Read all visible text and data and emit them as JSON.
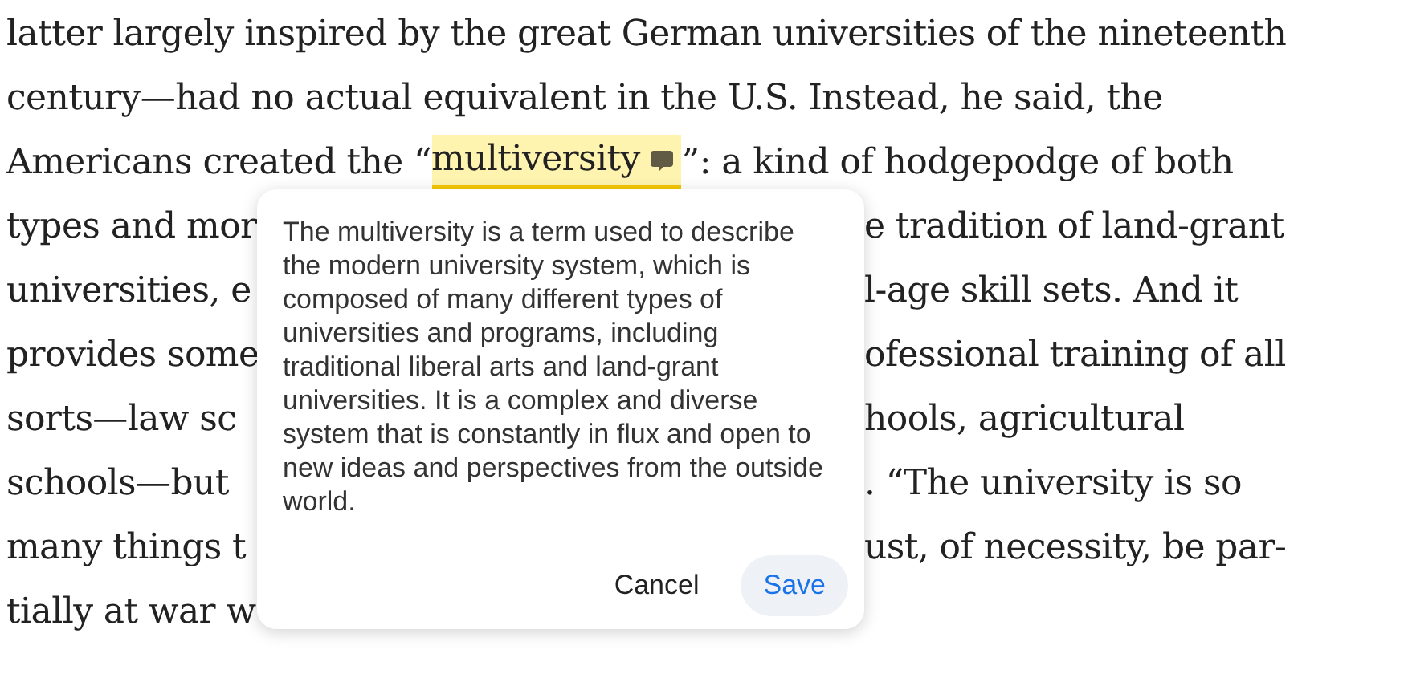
{
  "article": {
    "lines": [
      {
        "kind": "plain",
        "left": "latter largely inspired by the great German universities of the nineteenth"
      },
      {
        "kind": "plain",
        "left": "century—had no actual equivalent in the U.S. Instead, he said, the"
      },
      {
        "kind": "highlight",
        "before": "Americans created the “",
        "highlight": {
          "text": "multiversity",
          "has_note": true
        },
        "after": "”: a kind of hodgepodge of both"
      },
      {
        "kind": "plain",
        "left": "types and mor",
        "right": "e tradition of land-grant"
      },
      {
        "kind": "plain",
        "left": "universities, e",
        "right": "l-age skill sets. And it"
      },
      {
        "kind": "plain",
        "left": "provides some",
        "right": "ofessional training of all"
      },
      {
        "kind": "plain",
        "left": "sorts—law sc",
        "right": "hools, agricultural"
      },
      {
        "kind": "plain",
        "left": "schools—but",
        "right": ". “The university is so"
      },
      {
        "kind": "plain",
        "left": "many things t",
        "right": "ust, of necessity, be par-"
      },
      {
        "kind": "plain",
        "left": "tially at war w"
      }
    ]
  },
  "note_popup": {
    "value": "The multiversity is a term used to describe the modern university system, which is composed of many different types of universities and programs, including traditional liberal arts and land-grant universities. It is a complex and diverse system that is constantly in flux and open to new ideas and perspectives from the outside world.",
    "buttons": [
      {
        "label": "Cancel",
        "kind": "text"
      },
      {
        "label": "Save",
        "kind": "primary"
      }
    ]
  }
}
